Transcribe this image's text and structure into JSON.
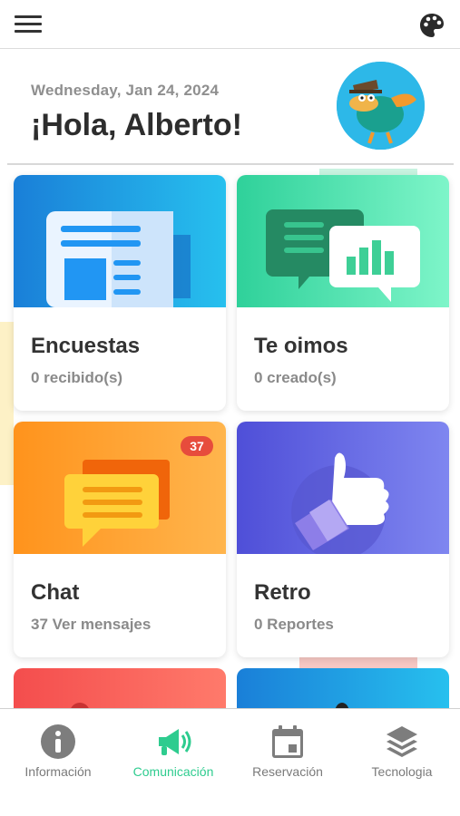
{
  "header": {
    "menu_icon": "hamburger-icon",
    "theme_icon": "palette-icon"
  },
  "greeting": {
    "date": "Wednesday, Jan 24, 2024",
    "hello": "¡Hola, Alberto!"
  },
  "cards": [
    {
      "title": "Encuestas",
      "subtitle": "0 recibido(s)",
      "icon": "newspaper-icon",
      "color": "#1e8fe0"
    },
    {
      "title": "Te oimos",
      "subtitle": "0 creado(s)",
      "icon": "chat-bubbles-icon",
      "color": "#3ed9a0"
    },
    {
      "title": "Chat",
      "subtitle": "37 Ver mensajes",
      "badge": "37",
      "icon": "message-icon",
      "color": "#ff9f2e"
    },
    {
      "title": "Retro",
      "subtitle": "0 Reportes",
      "icon": "thumbs-up-icon",
      "color": "#6a6fe8"
    }
  ],
  "bottom_nav": [
    {
      "label": "Información",
      "icon": "info-icon",
      "active": false
    },
    {
      "label": "Comunicación",
      "icon": "megaphone-icon",
      "active": true
    },
    {
      "label": "Reservación",
      "icon": "calendar-icon",
      "active": false
    },
    {
      "label": "Tecnologia",
      "icon": "layers-icon",
      "active": false
    }
  ],
  "colors": {
    "accent": "#2ecc8f",
    "badge": "#e74c3c",
    "text_dark": "#333333",
    "text_muted": "#8a8a8a"
  }
}
